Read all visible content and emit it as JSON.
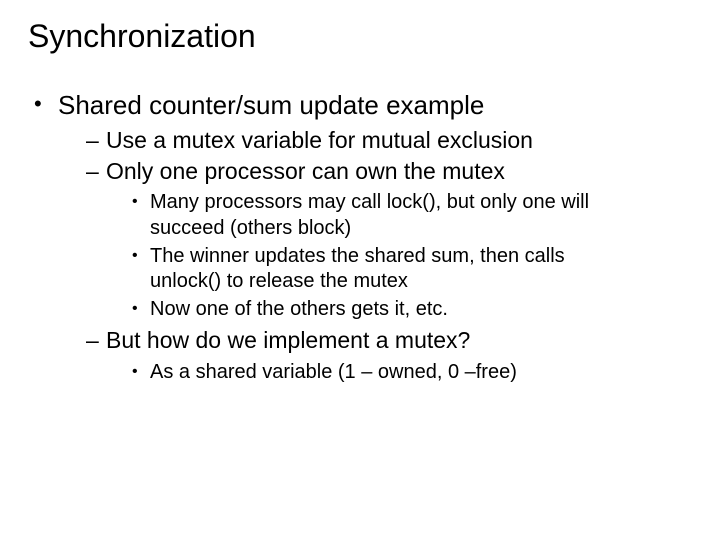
{
  "title": "Synchronization",
  "bullets": {
    "l1": "Shared counter/sum update example",
    "l2a": "Use a mutex variable for mutual exclusion",
    "l2b": "Only one processor can own the mutex",
    "l3a": "Many processors may call lock(), but only one will succeed (others block)",
    "l3b": "The winner updates the shared sum, then calls unlock() to release the mutex",
    "l3c": "Now one of the others gets it, etc.",
    "l2c": "But how do we implement a mutex?",
    "l3d": "As a shared variable (1 – owned, 0 –free)"
  }
}
